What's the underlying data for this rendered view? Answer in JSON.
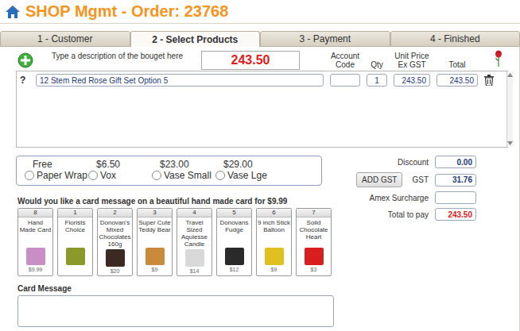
{
  "header": {
    "title": "SHOP Mgmt - Order: 23768"
  },
  "tabs": [
    {
      "label": "1 - Customer",
      "selected": false
    },
    {
      "label": "2 - Select Products",
      "selected": true
    },
    {
      "label": "3 - Payment",
      "selected": false
    },
    {
      "label": "4 - Finished",
      "selected": false
    }
  ],
  "products": {
    "hint": "Type a description of the bouget here",
    "order_total": "243.50",
    "columns": {
      "account": "Account Code",
      "qty": "Qty",
      "unit_price": "Unit Price Ex GST",
      "total": "Total"
    },
    "rows": [
      {
        "marker": "?",
        "description": "12 Stem Red Rose Gift Set Option 5",
        "account_code": "",
        "qty": "1",
        "unit_price": "243.50",
        "total": "243.50"
      }
    ]
  },
  "wrap_options": [
    {
      "price": "Free",
      "label": "Paper Wrap",
      "selected": false
    },
    {
      "price": "$6.50",
      "label": "Vox",
      "selected": false
    },
    {
      "price": "$23.00",
      "label": "Vase Small",
      "selected": false
    },
    {
      "price": "$29.00",
      "label": "Vase Lge",
      "selected": false
    }
  ],
  "totals": {
    "discount_label": "Discount",
    "discount": "0.00",
    "add_gst_button": "ADD GST",
    "gst_label": "GST",
    "gst": "31.76",
    "amex_label": "Amex Surcharge",
    "amex": "",
    "total_label": "Total to pay",
    "total": "243.50"
  },
  "card_offer": {
    "title": "Would you like a card message on a beautiful hand made card for $9.99",
    "items": [
      {
        "number": "8",
        "name": "Hand Made Card",
        "price": "$9.99",
        "color": "#c98fc4"
      },
      {
        "number": "1",
        "name": "Florists Choice",
        "price": "",
        "color": "#8a9a2a"
      },
      {
        "number": "2",
        "name": "Donovan's Mixed Chocolates 160g",
        "price": "$20",
        "color": "#3a2a22"
      },
      {
        "number": "3",
        "name": "Super Cute Teddy Bear",
        "price": "$9",
        "color": "#c98a3a"
      },
      {
        "number": "4",
        "name": "Travel Sized Aquiesse Candle",
        "price": "$14",
        "color": "#d8d8d8"
      },
      {
        "number": "5",
        "name": "Donovans Fudge",
        "price": "$12",
        "color": "#2a2a2a"
      },
      {
        "number": "6",
        "name": "9 inch Stick Balloon",
        "price": "$9",
        "color": "#e0c020"
      },
      {
        "number": "7",
        "name": "Solid Chocolate Heart",
        "price": "$3",
        "color": "#d81e1e"
      }
    ]
  },
  "card_message": {
    "label": "Card Message",
    "value": ""
  }
}
